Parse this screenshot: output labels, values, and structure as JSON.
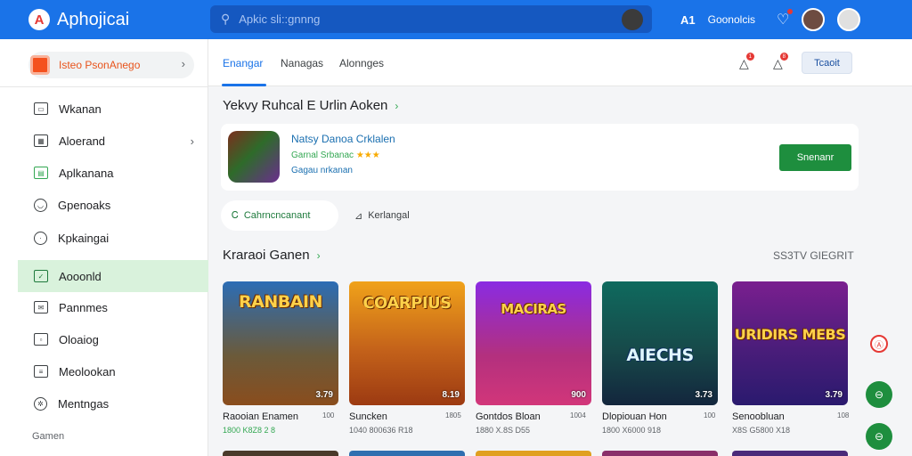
{
  "header": {
    "logo_mark": "A",
    "app_name": "Aphojicai",
    "search_placeholder": "Apkic sli::gnnng",
    "brand_icon": "A1",
    "brand_text": "Goonolcis",
    "icons": [
      "search-icon",
      "bell-icon",
      "avatar"
    ]
  },
  "sidebar": {
    "app_pill": "Isteo PsonAnego",
    "items": [
      {
        "label": "Wkanan",
        "icon": "monitor-icon"
      },
      {
        "label": "Aloerand",
        "icon": "calendar-icon"
      },
      {
        "label": "Aplkanana",
        "icon": "chart-icon"
      },
      {
        "label": "Gpenoaks",
        "icon": "smile-icon"
      },
      {
        "label": "Kpkaingai",
        "icon": "circle-dot-icon"
      },
      {
        "label": "Aooonld",
        "icon": "checkbox-icon"
      },
      {
        "label": "Pannmes",
        "icon": "mail-icon"
      },
      {
        "label": "Oloaiog",
        "icon": "box-icon"
      },
      {
        "label": "Meolookan",
        "icon": "document-icon"
      },
      {
        "label": "Mentngas",
        "icon": "settings-icon"
      }
    ],
    "footer": "Gamen"
  },
  "tabs": [
    {
      "label": "Enangar",
      "active": true
    },
    {
      "label": "Nanagas",
      "active": false
    },
    {
      "label": "Alonnges",
      "active": false
    }
  ],
  "header_actions": {
    "button_label": "Tcaoit",
    "badge1": "1",
    "badge2": "8"
  },
  "section1": {
    "title": "Yekvy Ruhcal E Urlin Aoken",
    "arrow": "›"
  },
  "featured": {
    "title": "Natsy Danoa Crklalen",
    "subtitle": "Garnal Srbanac",
    "stars": "★★★",
    "meta": "Gagau nrkanan",
    "button": "Snenanr"
  },
  "chips": [
    {
      "icon": "Ꮯ",
      "label": "Cahrncncanant"
    },
    {
      "icon": "⊿",
      "label": "Kerlangal"
    }
  ],
  "section2": {
    "title": "Kraraoi Ganen",
    "arrow": "›",
    "see_all": "SS3TV GIEGRIT"
  },
  "games": [
    {
      "art_title": "RANBAIN",
      "price": "3.79",
      "name": "Raooian Enamen",
      "size": "100",
      "stats": "1800 K8Z8 2 8",
      "bg_top": "#2c6db5",
      "bg_bottom": "#8a4d1d"
    },
    {
      "art_title": "COARPIUS",
      "price": "8.19",
      "name": "Suncken",
      "size": "1805",
      "stats": "1040 800636 R18",
      "bg_top": "#f0a21a",
      "bg_bottom": "#9c3a12"
    },
    {
      "art_title": "MACIRAS",
      "price": "900",
      "name": "Gontdos Bloan",
      "size": "1004",
      "stats": "1880 X.8S D55",
      "bg_top": "#8a2be2",
      "bg_bottom": "#d2367a"
    },
    {
      "art_title": "AIECHS",
      "price": "3.73",
      "name": "Dlopiouan Hon",
      "size": "100",
      "stats": "1800 X6000 918",
      "bg_top": "#0f6a5e",
      "bg_bottom": "#13263d"
    },
    {
      "art_title": "URIDIRS MEBS",
      "price": "3.79",
      "name": "Senoobluan",
      "size": "108",
      "stats": "X8S G5800 X18",
      "bg_top": "#7a1f8f",
      "bg_bottom": "#2a1a6e"
    }
  ],
  "fabs": {
    "red": "Ⓐ",
    "green1": "⊖",
    "green2": "⊖"
  }
}
